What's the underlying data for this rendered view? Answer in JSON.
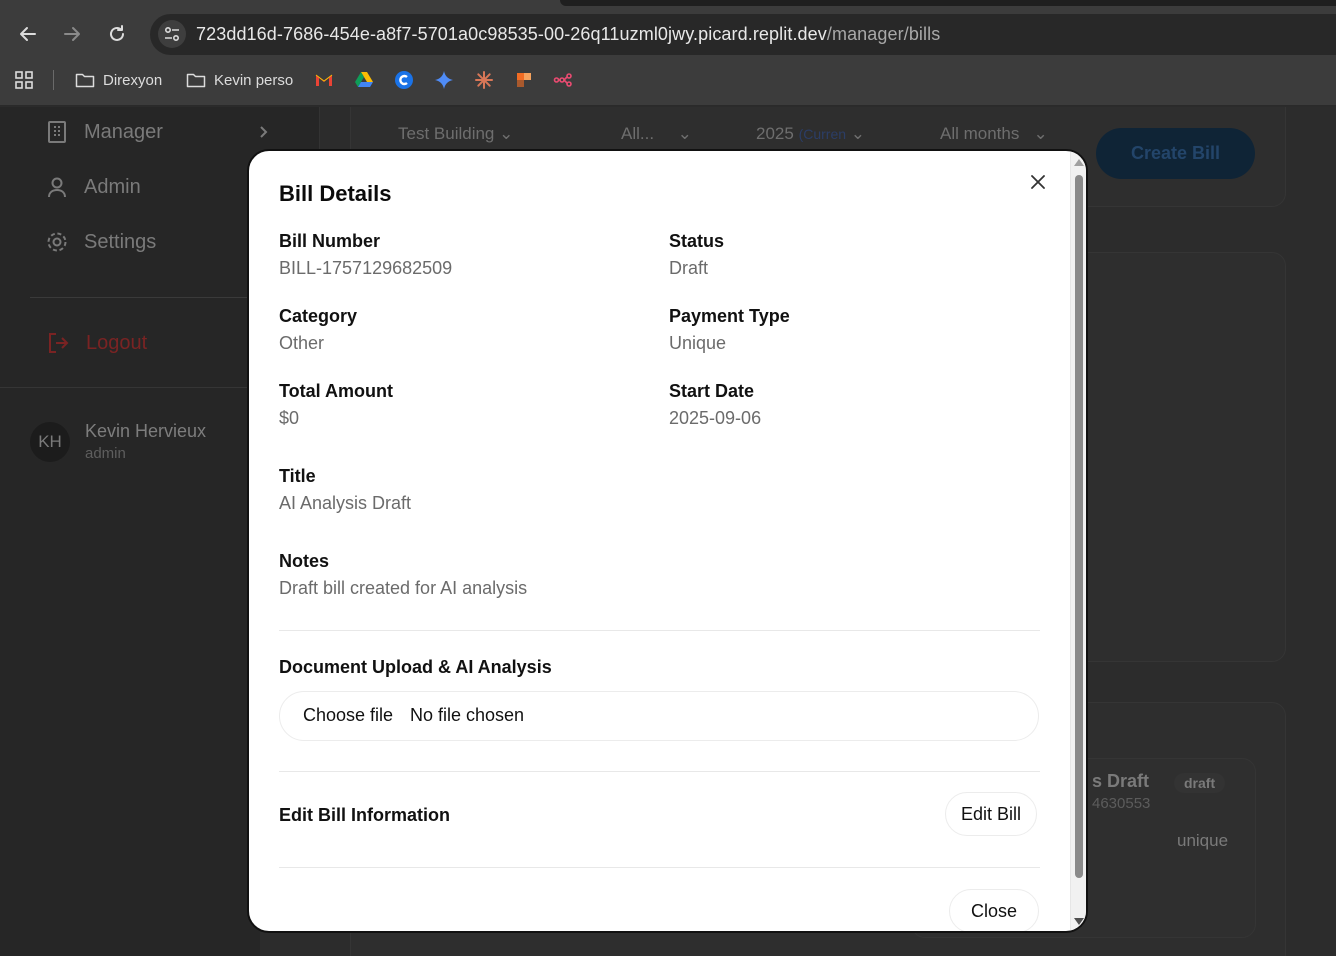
{
  "browser": {
    "url_host": "723dd16d-7686-454e-a8f7-5701a0c98535-00-26q11uzml0jwy.picard.replit.dev",
    "url_path": "/manager/bills",
    "bookmarks": [
      {
        "label": "Direxyon",
        "icon": "folder-icon"
      },
      {
        "label": "Kevin perso",
        "icon": "folder-icon"
      }
    ],
    "bookmark_icons": [
      "gmail-icon",
      "google-drive-icon",
      "c-app-icon",
      "gemini-icon",
      "claude-icon",
      "figma-like-icon",
      "workflow-icon"
    ]
  },
  "sidebar": {
    "items": [
      {
        "label": "Manager",
        "icon": "building-icon"
      },
      {
        "label": "Admin",
        "icon": "user-icon"
      },
      {
        "label": "Settings",
        "icon": "gear-icon"
      }
    ],
    "logout_label": "Logout",
    "user": {
      "initials": "KH",
      "name": "Kevin Hervieux",
      "role": "admin"
    }
  },
  "filters": {
    "building": "Test Building",
    "type": "All...",
    "year": "2025",
    "year_suffix": "(Curren",
    "months": "All months",
    "create_label": "Create Bill"
  },
  "background_card": {
    "title_fragment": "s Draft",
    "number_fragment": "4630553",
    "badge": "draft",
    "payment": "unique"
  },
  "modal": {
    "title": "Bill Details",
    "fields": {
      "bill_number_label": "Bill Number",
      "bill_number": "BILL-1757129682509",
      "status_label": "Status",
      "status": "Draft",
      "category_label": "Category",
      "category": "Other",
      "payment_type_label": "Payment Type",
      "payment_type": "Unique",
      "total_amount_label": "Total Amount",
      "total_amount": "$0",
      "start_date_label": "Start Date",
      "start_date": "2025-09-06",
      "title_label": "Title",
      "title": "AI Analysis Draft",
      "notes_label": "Notes",
      "notes": "Draft bill created for AI analysis"
    },
    "upload_heading": "Document Upload & AI Analysis",
    "file_button": "Choose file",
    "file_status": "No file chosen",
    "edit_heading": "Edit Bill Information",
    "edit_button": "Edit Bill",
    "close_button": "Close"
  }
}
